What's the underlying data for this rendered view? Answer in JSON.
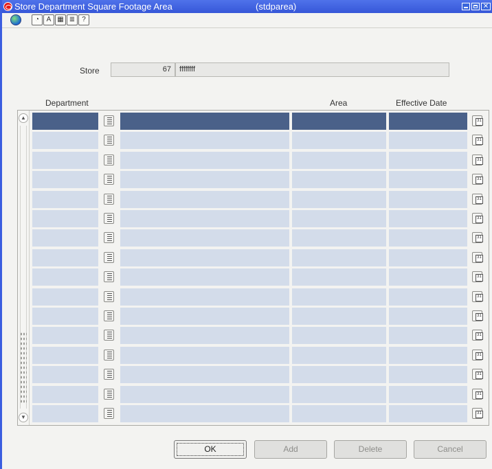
{
  "window": {
    "title": "Store Department Square Footage Area",
    "form_code": "(stdparea)"
  },
  "toolbar": {
    "icons": [
      "globe-icon",
      "help-topics-icon",
      "font-icon",
      "calendar-icon",
      "notes-icon",
      "help-icon"
    ]
  },
  "store": {
    "label": "Store",
    "number": "67",
    "name": "ffffffff"
  },
  "grid": {
    "headers": {
      "department": "Department",
      "area": "Area",
      "effective_date": "Effective Date"
    },
    "rows": [
      {
        "department": "",
        "description": "",
        "area": "",
        "effective_date": "",
        "selected": true
      },
      {
        "department": "",
        "description": "",
        "area": "",
        "effective_date": ""
      },
      {
        "department": "",
        "description": "",
        "area": "",
        "effective_date": ""
      },
      {
        "department": "",
        "description": "",
        "area": "",
        "effective_date": ""
      },
      {
        "department": "",
        "description": "",
        "area": "",
        "effective_date": ""
      },
      {
        "department": "",
        "description": "",
        "area": "",
        "effective_date": ""
      },
      {
        "department": "",
        "description": "",
        "area": "",
        "effective_date": ""
      },
      {
        "department": "",
        "description": "",
        "area": "",
        "effective_date": ""
      },
      {
        "department": "",
        "description": "",
        "area": "",
        "effective_date": ""
      },
      {
        "department": "",
        "description": "",
        "area": "",
        "effective_date": ""
      },
      {
        "department": "",
        "description": "",
        "area": "",
        "effective_date": ""
      },
      {
        "department": "",
        "description": "",
        "area": "",
        "effective_date": ""
      },
      {
        "department": "",
        "description": "",
        "area": "",
        "effective_date": ""
      },
      {
        "department": "",
        "description": "",
        "area": "",
        "effective_date": ""
      },
      {
        "department": "",
        "description": "",
        "area": "",
        "effective_date": ""
      },
      {
        "department": "",
        "description": "",
        "area": "",
        "effective_date": ""
      }
    ]
  },
  "buttons": {
    "ok": "OK",
    "add": "Add",
    "delete": "Delete",
    "cancel": "Cancel"
  },
  "colors": {
    "titlebar": "#3b5de0",
    "row_selected": "#4a6189",
    "row_normal": "#d3dcea"
  }
}
